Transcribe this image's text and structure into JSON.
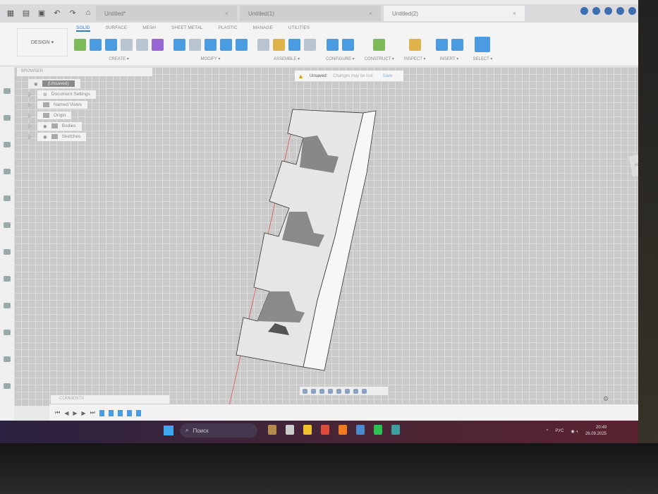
{
  "titlebar": {
    "tabs": [
      "Untitled*",
      "Untitled(1)",
      "Untitled(2)"
    ]
  },
  "toolbar": {
    "workspace": "DESIGN ▾",
    "tabs": [
      "SOLID",
      "SURFACE",
      "MESH",
      "SHEET METAL",
      "PLASTIC",
      "MANAGE",
      "UTILITIES"
    ],
    "groups": [
      "CREATE ▾",
      "MODIFY ▾",
      "ASSEMBLE ▾",
      "CONFIGURE ▾",
      "CONSTRUCT ▾",
      "INSPECT ▾",
      "INSERT ▾",
      "SELECT ▾"
    ]
  },
  "browser": {
    "title": "BROWSER",
    "root": "(Unsaved)",
    "items": [
      "Document Settings",
      "Named Views",
      "Origin",
      "Bodies",
      "Sketches"
    ]
  },
  "banner": {
    "label": "Unsaved:",
    "message": "Changes may be lost",
    "save": "Save"
  },
  "viewcube": {
    "label": "FRONT"
  },
  "comments": {
    "title": "COMMENTS"
  },
  "timeline": {
    "controls": [
      "⏮",
      "◀",
      "▶",
      "▶",
      "⏭"
    ]
  },
  "taskbar": {
    "search": "Поиск",
    "lang": "РУС",
    "time": "20:49",
    "date": "26.09.2025"
  },
  "colors": {
    "accent": "#2d7bd1",
    "viewport": "#c9c9ca"
  }
}
